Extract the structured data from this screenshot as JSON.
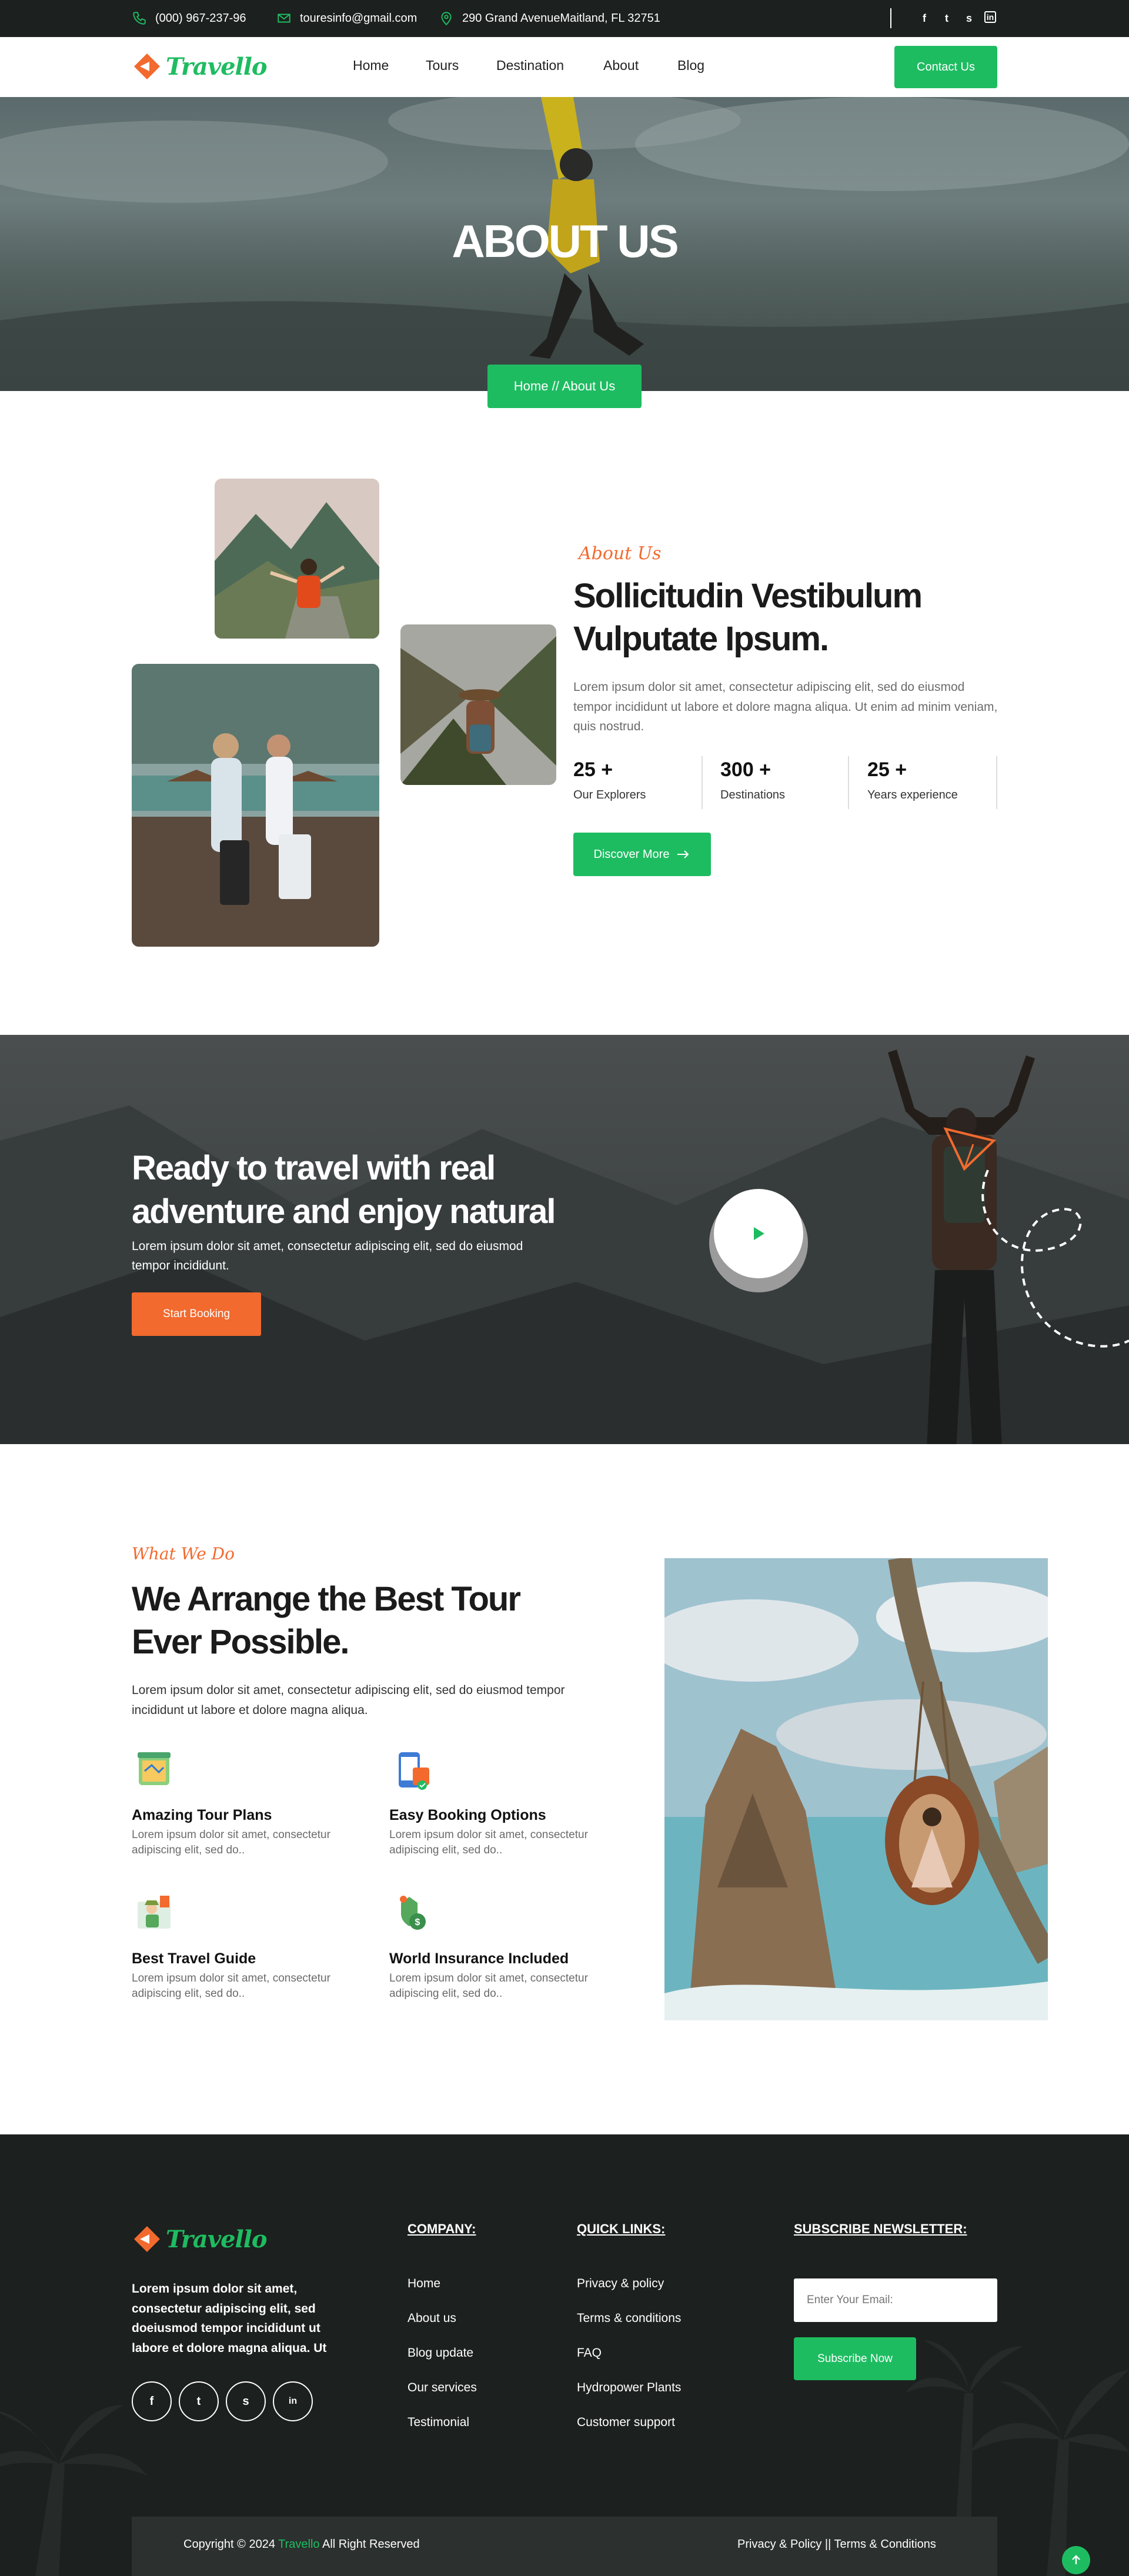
{
  "topbar": {
    "phone": "(000) 967-237-96",
    "email": "touresinfo@gmail.com",
    "address": "290 Grand AvenueMaitland, FL 32751",
    "social": [
      "f",
      "t",
      "s",
      "in"
    ]
  },
  "nav": {
    "brand": "Travello",
    "links": [
      "Home",
      "Tours",
      "Destination",
      "About",
      "Blog"
    ],
    "cta": "Contact Us"
  },
  "hero": {
    "title": "ABOUT US",
    "breadcrumb": "Home // About Us"
  },
  "about": {
    "eyebrow": "About Us",
    "title": "Sollicitudin Vestibulum Vulputate Ipsum.",
    "text": "Lorem ipsum dolor sit amet, consectetur adipiscing elit, sed do eiusmod tempor incididunt ut labore et dolore magna aliqua. Ut enim ad minim veniam, quis nostrud.",
    "stats": [
      {
        "value": "25 +",
        "label": "Our Explorers"
      },
      {
        "value": "300 +",
        "label": "Destinations"
      },
      {
        "value": "25 +",
        "label": "Years experience"
      }
    ],
    "button": "Discover More"
  },
  "band": {
    "title": "Ready to travel with real adventure and enjoy natural",
    "text": "Lorem ipsum dolor sit amet, consectetur adipiscing elit, sed do eiusmod tempor incididunt.",
    "button": "Start Booking"
  },
  "services": {
    "eyebrow": "What We Do",
    "title": "We Arrange the Best Tour Ever Possible.",
    "text": "Lorem ipsum dolor sit amet, consectetur adipiscing elit, sed do eiusmod tempor incididunt ut labore et dolore magna aliqua.",
    "items": [
      {
        "title": "Amazing Tour Plans",
        "desc": "Lorem ipsum dolor sit amet, consectetur adipiscing elit, sed do.."
      },
      {
        "title": "Easy Booking Options",
        "desc": "Lorem ipsum dolor sit amet, consectetur adipiscing elit, sed do.."
      },
      {
        "title": "Best Travel Guide",
        "desc": "Lorem ipsum dolor sit amet, consectetur adipiscing elit, sed do.."
      },
      {
        "title": "World Insurance Included",
        "desc": "Lorem ipsum dolor sit amet, consectetur adipiscing elit, sed do.."
      }
    ]
  },
  "footer": {
    "brand": "Travello",
    "about": "Lorem ipsum dolor sit amet, consectetur adipiscing elit, sed doeiusmod tempor incididunt ut labore et dolore magna aliqua. Ut",
    "social": [
      "f",
      "t",
      "s",
      "in"
    ],
    "company_heading": "COMPANY:",
    "company_links": [
      "Home",
      "About us",
      "Blog update",
      "Our services",
      "Testimonial"
    ],
    "quick_heading": "QUICK LINKS:",
    "quick_links": [
      "Privacy & policy",
      "Terms & conditions",
      "FAQ",
      "Hydropower Plants",
      "Customer support"
    ],
    "newsletter_heading": "SUBSCRIBE NEWSLETTER:",
    "email_placeholder": "Enter Your Email:",
    "subscribe": "Subscribe Now",
    "copyright_pre": "Copyright © 2024 ",
    "copyright_brand": "Travello",
    "copyright_post": " All Right Reserved",
    "legal": "Privacy & Policy || Terms & Conditions"
  },
  "colors": {
    "green": "#1ebc61",
    "orange": "#f26a2e",
    "dark": "#1c201e"
  }
}
